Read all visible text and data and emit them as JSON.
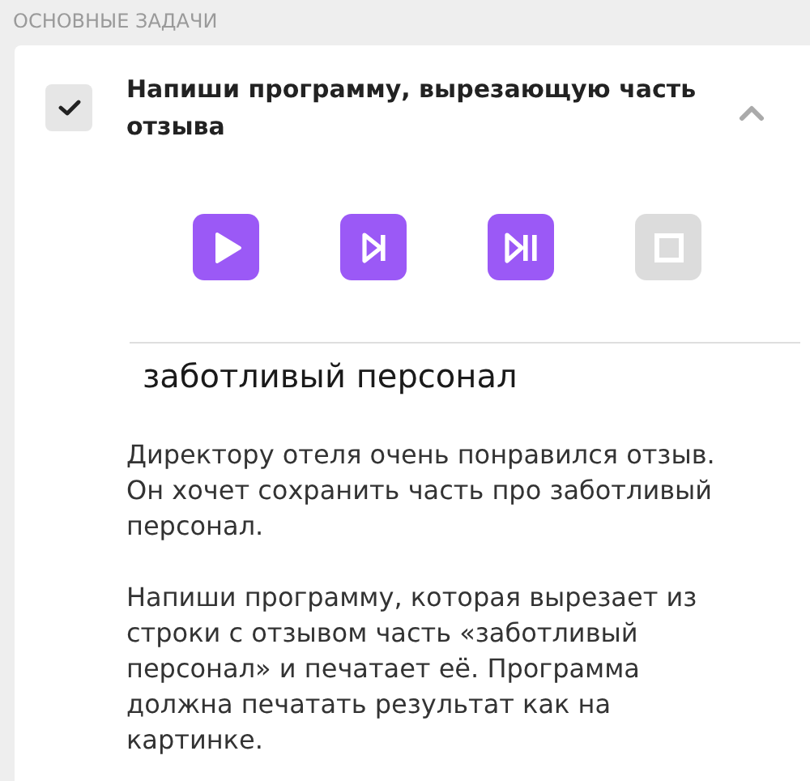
{
  "section_title": "ОСНОВНЫЕ ЗАДАЧИ",
  "task": {
    "title": "Напиши программу, вырезающую часть отзыва",
    "checked": true,
    "expanded": true
  },
  "controls": [
    {
      "kind": "play",
      "disabled": false
    },
    {
      "kind": "step",
      "disabled": false
    },
    {
      "kind": "step-pause",
      "disabled": false
    },
    {
      "kind": "stop",
      "disabled": true
    }
  ],
  "output": "заботливый персонал",
  "paragraphs": [
    "Директору отеля очень понравился отзыв. Он хочет сохранить часть про заботливый персонал.",
    "Напиши программу, которая вырезает из строки с отзывом часть «заботливый персонал» и печатает её. Программа должна печатать результат как на картинке."
  ]
}
